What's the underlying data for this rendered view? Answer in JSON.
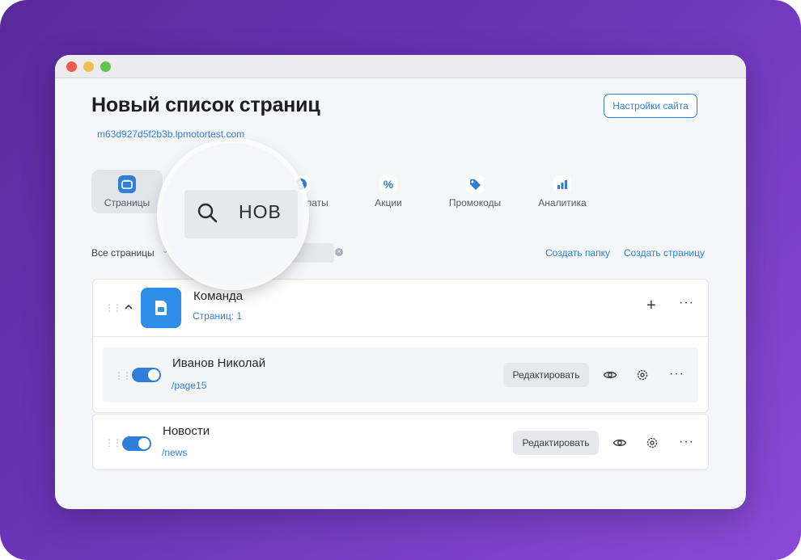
{
  "page": {
    "title": "Новый список страниц",
    "domain": "m63d927d5f2b3b.lpmotortest.com",
    "settings_button": "Настройки сайта"
  },
  "tabs": [
    {
      "label": "Страницы",
      "icon": "pages-icon",
      "active": true
    },
    {
      "label": "Оплаты",
      "icon": "payments-icon",
      "active": false
    },
    {
      "label": "Акции",
      "icon": "percent-icon",
      "active": false
    },
    {
      "label": "Промокоды",
      "icon": "tag-icon",
      "active": false
    },
    {
      "label": "Аналитика",
      "icon": "chart-icon",
      "active": false
    }
  ],
  "visible_tab_fragment": "латы",
  "filter": {
    "label": "Все страницы",
    "search_value": "нов"
  },
  "actions": {
    "create_folder": "Создать папку",
    "create_page": "Создать страницу"
  },
  "folder": {
    "title": "Команда",
    "count": "Страниц: 1",
    "pages": [
      {
        "title": "Иванов Николай",
        "path": "/page15",
        "edit": "Редактировать",
        "enabled": true
      }
    ]
  },
  "pages": [
    {
      "title": "Новости",
      "path": "/news",
      "edit": "Редактировать",
      "enabled": true
    }
  ],
  "colors": {
    "accent": "#2f7fd8",
    "folder_blue": "#2f8fe8",
    "background_gradient_start": "#5a2a9c",
    "background_gradient_end": "#8a4ad6"
  }
}
